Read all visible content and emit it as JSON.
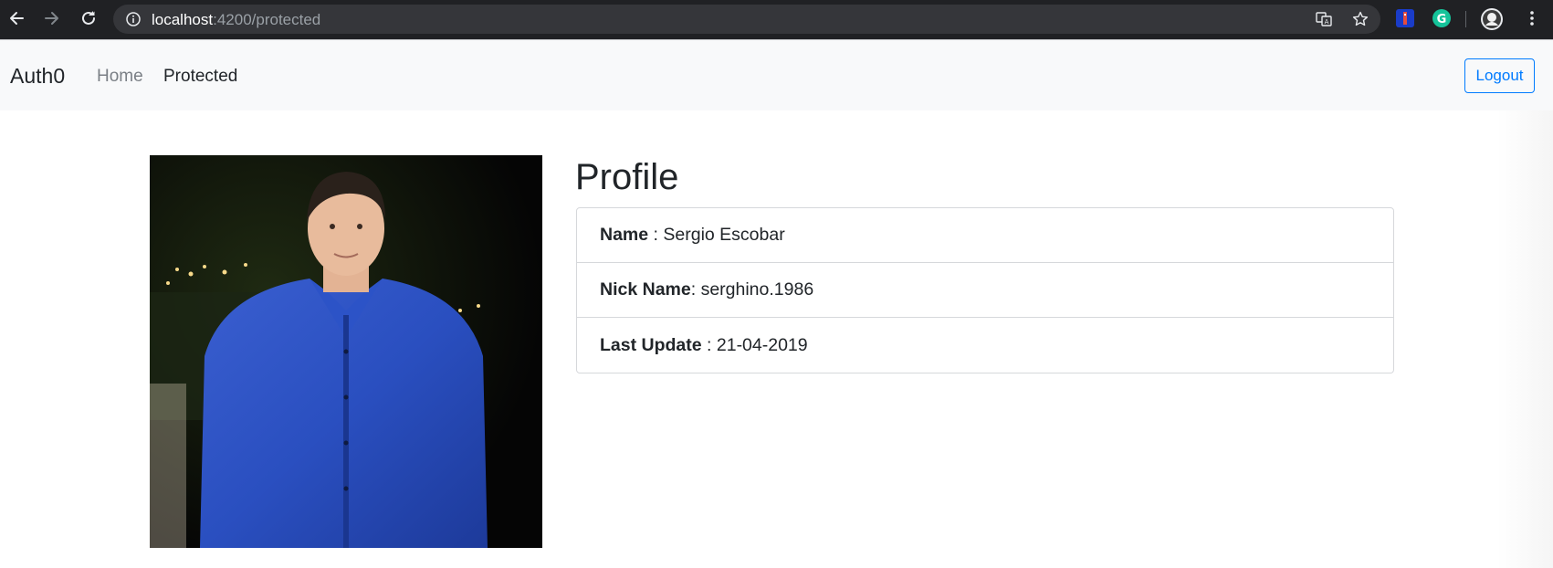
{
  "browser": {
    "url_host": "localhost",
    "url_path": ":4200/protected",
    "icons": {
      "back": "back-arrow-icon",
      "forward": "forward-arrow-icon",
      "reload": "reload-icon",
      "info": "info-icon",
      "translate": "translate-icon",
      "bookmark": "star-icon",
      "menu": "kebab-menu-icon"
    }
  },
  "navbar": {
    "brand": "Auth0",
    "links": [
      {
        "label": "Home"
      },
      {
        "label": "Protected"
      }
    ],
    "logout_label": "Logout"
  },
  "profile": {
    "title": "Profile",
    "fields": [
      {
        "label": "Name",
        "sep": " : ",
        "value": "Sergio Escobar"
      },
      {
        "label": "Nick Name",
        "sep": ": ",
        "value": "serghino.1986"
      },
      {
        "label": "Last Update",
        "sep": " : ",
        "value": "21-04-2019"
      }
    ]
  },
  "colors": {
    "primary": "#007bff",
    "navbar_bg": "#f8f9fa",
    "chrome_bg": "#202124"
  }
}
